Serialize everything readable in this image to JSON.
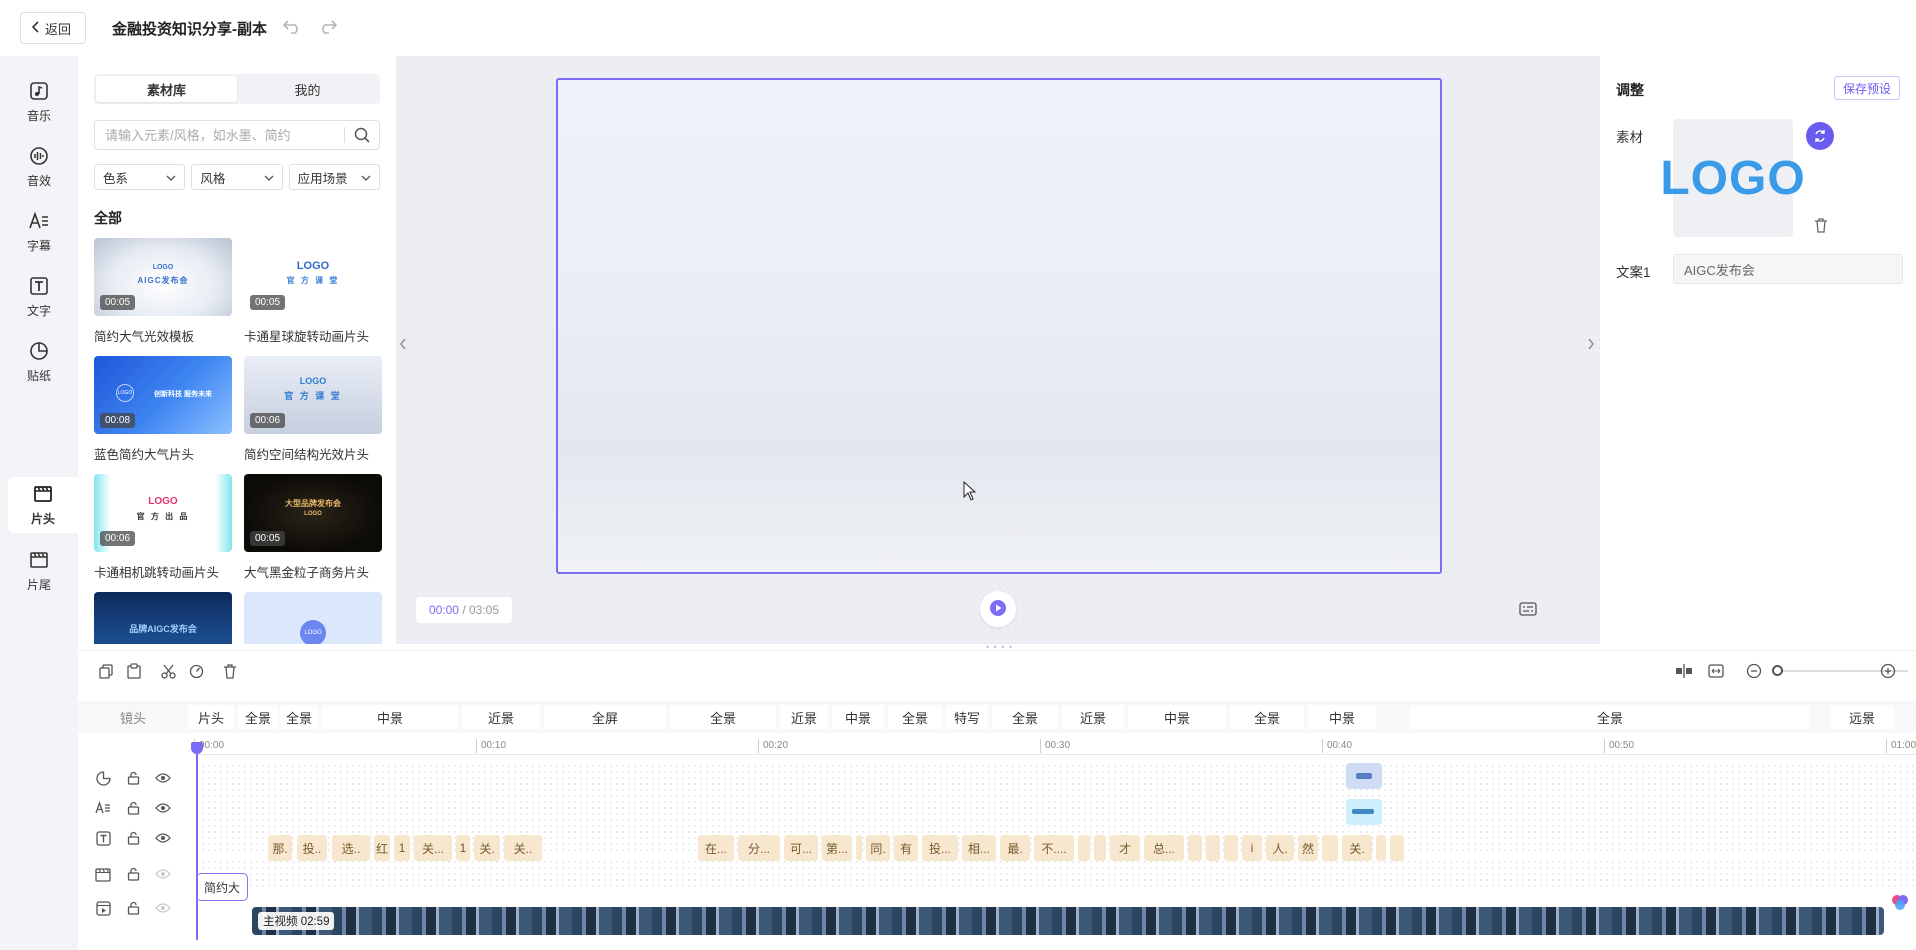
{
  "topbar": {
    "back_label": "返回",
    "project_title": "金融投资知识分享-副本"
  },
  "rail": {
    "items": [
      {
        "label": "音乐",
        "icon": "music-note-icon"
      },
      {
        "label": "音效",
        "icon": "sound-wave-icon"
      },
      {
        "label": "字幕",
        "icon": "subtitle-icon"
      },
      {
        "label": "文字",
        "icon": "text-icon"
      },
      {
        "label": "贴纸",
        "icon": "sticker-icon"
      },
      {
        "label": "片头",
        "icon": "clapper-icon",
        "active": true
      },
      {
        "label": "片尾",
        "icon": "clapper-icon"
      }
    ]
  },
  "assets": {
    "tabs": [
      "素材库",
      "我的"
    ],
    "search_placeholder": "请输入元素/风格，如水墨、简约",
    "filters": [
      "色系",
      "风格",
      "应用场景"
    ],
    "section_title": "全部",
    "cards": [
      {
        "name": "简约大气光效模板",
        "duration": "00:05",
        "thumb_text": "LOGO",
        "thumb_sub": "AIGC发布会"
      },
      {
        "name": "卡通星球旋转动画片头",
        "duration": "00:05",
        "thumb_text": "LOGO",
        "thumb_sub": "官 方 课 堂"
      },
      {
        "name": "蓝色简约大气片头",
        "duration": "00:08",
        "thumb_text": "LOGO",
        "thumb_sub": "创新科技 服务未来"
      },
      {
        "name": "简约空间结构光效片头",
        "duration": "00:06",
        "thumb_text": "LOGO",
        "thumb_sub": "官 方 课 堂"
      },
      {
        "name": "卡通相机跳转动画片头",
        "duration": "00:06",
        "thumb_text": "LOGO",
        "thumb_sub": "官 方 出 品"
      },
      {
        "name": "大气黑金粒子商务片头",
        "duration": "00:05",
        "thumb_text": "大型品牌发布会",
        "thumb_sub": "LOGO"
      },
      {
        "name": "",
        "duration": "",
        "thumb_text": "",
        "thumb_sub": "品牌AIGC发布会"
      },
      {
        "name": "",
        "duration": "",
        "thumb_text": "LOGO",
        "thumb_sub": ""
      }
    ]
  },
  "preview": {
    "current_time": "00:00",
    "total_time": "/ 03:05"
  },
  "adjust": {
    "title": "调整",
    "save_preset": "保存预设",
    "material_label": "素材",
    "logo_text": "LOGO",
    "copy_label": "文案1",
    "copy_value": "AIGC发布会"
  },
  "timeline": {
    "shot_header": "镜头",
    "shots": [
      "片头",
      "全景",
      "全景",
      "中景",
      "近景",
      "全屏",
      "全景",
      "近景",
      "中景",
      "全景",
      "特写",
      "全景",
      "近景",
      "中景",
      "全景",
      "中景",
      "全景",
      "远景"
    ],
    "ruler": [
      "00:00",
      "00:10",
      "00:20",
      "00:30",
      "00:40",
      "00:50",
      "01:00"
    ],
    "text_clips": [
      "那.",
      "投..",
      "选..",
      "红",
      "1",
      "关...",
      "1",
      "关.",
      "关..",
      "在...",
      "分...",
      "可...",
      "第...",
      "",
      "同.",
      "有",
      "投...",
      "相...",
      "最.",
      "不....",
      "",
      "",
      "才",
      "总...",
      "",
      "",
      "",
      "i",
      "人.",
      "然",
      "",
      "关.",
      "",
      ""
    ],
    "header_clip": "简约大",
    "main_video": "主视频 02:59"
  },
  "colors": {
    "accent": "#7b6cf6",
    "text_clip": "#f7e7cf",
    "logo_blue": "#3a9be8"
  }
}
